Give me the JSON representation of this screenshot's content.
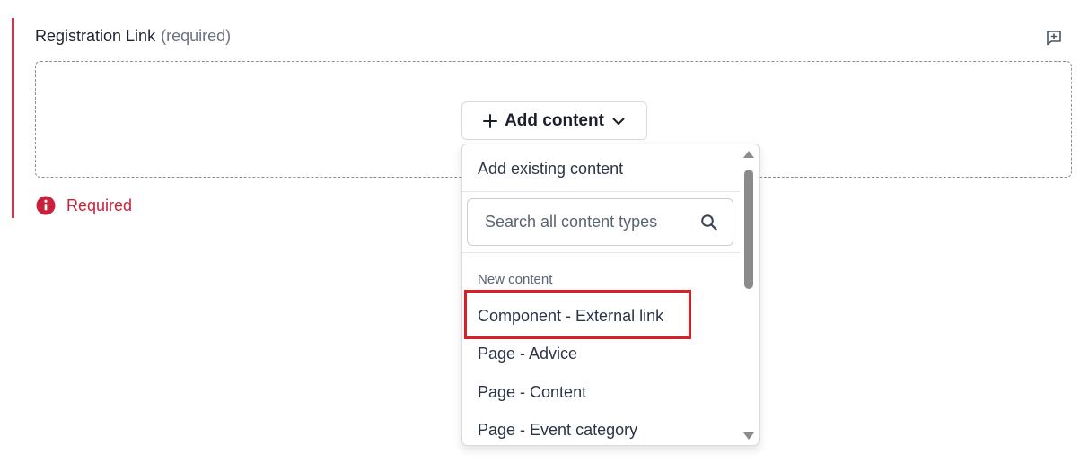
{
  "field": {
    "label": "Registration Link",
    "required_hint": "(required)",
    "error_message": "Required"
  },
  "icons": {
    "comment": "add-comment-icon",
    "plus": "plus-icon",
    "chevron": "chevron-down-icon",
    "error": "info-circle-icon",
    "search": "search-icon"
  },
  "add_content": {
    "label": "Add content"
  },
  "dropdown": {
    "existing": "Add existing content",
    "search_placeholder": "Search all content types",
    "group_label": "New content",
    "items": [
      "Component - External link",
      "Page - Advice",
      "Page - Content",
      "Page - Event category"
    ],
    "highlighted_index": 0
  },
  "colors": {
    "error": "#d1344b",
    "highlight": "#dc1f26"
  }
}
